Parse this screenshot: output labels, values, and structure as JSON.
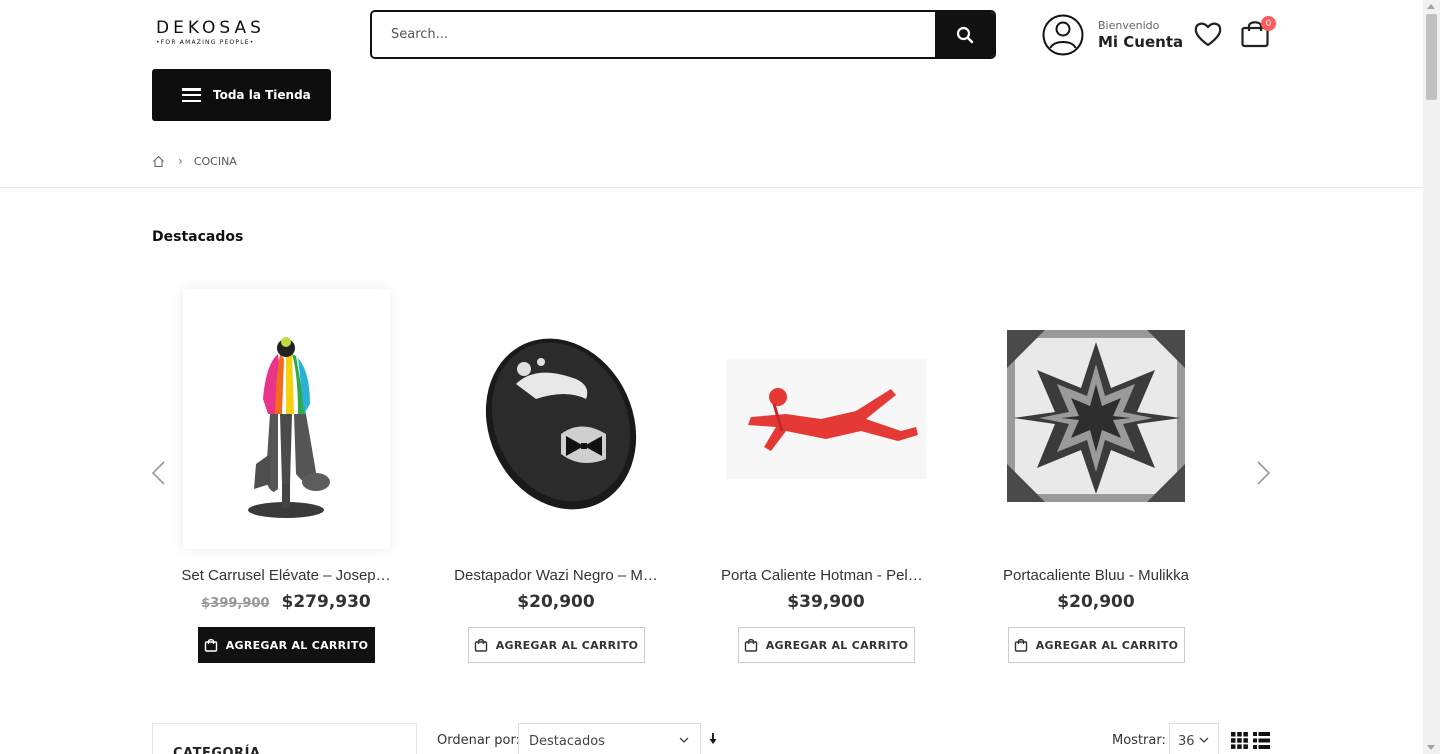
{
  "header": {
    "logo_main": "DEKOSAS",
    "logo_sub": "•FOR AMAZING PEOPLE•",
    "search_placeholder": "Search...",
    "account_welcome": "Bienvenido",
    "account_name": "Mi Cuenta",
    "cart_count": "0",
    "all_store_label": "Toda la Tienda"
  },
  "breadcrumb": {
    "current": "COCINA"
  },
  "section_title": "Destacados",
  "products": [
    {
      "name": "Set Carrusel Elévate – Josep…",
      "old_price": "$399,900",
      "price": "$279,930",
      "button": "AGREGAR AL CARRITO"
    },
    {
      "name": "Destapador Wazi Negro – M…",
      "old_price": "",
      "price": "$20,900",
      "button": "AGREGAR AL CARRITO"
    },
    {
      "name": "Porta Caliente Hotman - Pele…",
      "old_price": "",
      "price": "$39,900",
      "button": "AGREGAR AL CARRITO"
    },
    {
      "name": "Portacaliente Bluu - Mulikka",
      "old_price": "",
      "price": "$20,900",
      "button": "AGREGAR AL CARRITO"
    }
  ],
  "toolbar": {
    "category_title": "CATEGORÍA",
    "sort_label": "Ordenar por:",
    "sort_value": "Destacados",
    "show_label": "Mostrar:",
    "show_value": "36"
  },
  "colors": {
    "accent": "#111111",
    "badge": "#ff5b5b",
    "scrollbar": "#c1c1c1"
  }
}
